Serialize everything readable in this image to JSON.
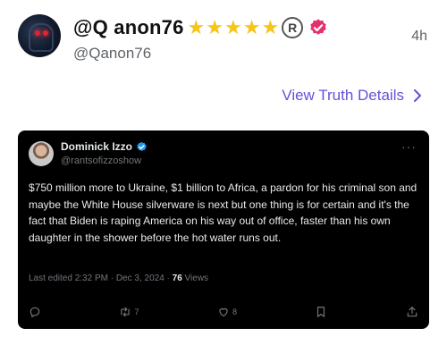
{
  "post": {
    "display_name": "@Q anon76",
    "handle": "@Qanon76",
    "time": "4h",
    "stars_count": 5,
    "accent_pink": "#e4306c",
    "star_color": "#f5c518"
  },
  "details_link": {
    "label": "View Truth Details",
    "color": "#6b4fd8"
  },
  "embedded_tweet": {
    "author_name": "Dominick Izzo",
    "author_handle": "@rantsofizzoshow",
    "more": "···",
    "body": "$750 million more to Ukraine, $1 billion to Africa, a pardon for his criminal son and maybe the White House silverware is next but one thing is for certain and it's the fact that Biden is raping America on his way out of office, faster than his own daughter in the shower before the hot water runs out.",
    "meta_prefix": "Last edited 2:32 PM · Dec 3, 2024 · ",
    "views_count": "76",
    "views_label": " Views",
    "retweets": "7",
    "likes": "8",
    "background": "#000000",
    "verified_color": "#1d9bf0"
  }
}
